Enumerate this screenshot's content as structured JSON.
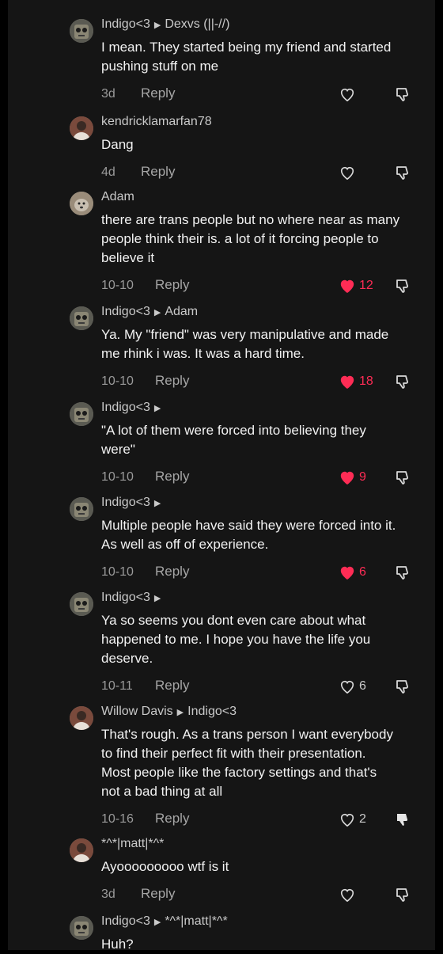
{
  "comments": [
    {
      "author": "Indigo<3",
      "reply_to": "Dexvs (||-//)",
      "avatar": "robot-avatar",
      "lines": [
        "I mean. They started being my friend and started",
        "pushing stuff on me"
      ],
      "time": "3d",
      "reply_label": "Reply",
      "likes": "",
      "liked": false,
      "disliked": false
    },
    {
      "author": "kendricklamarfan78",
      "reply_to": "",
      "avatar": "person-avatar",
      "lines": [
        "Dang"
      ],
      "time": "4d",
      "reply_label": "Reply",
      "likes": "",
      "liked": false,
      "disliked": false
    },
    {
      "author": "Adam",
      "reply_to": "",
      "avatar": "dog-avatar",
      "lines": [
        "there are trans people but no where near as many",
        "people think their is. a lot of it forcing people to",
        "believe it"
      ],
      "time": "10-10",
      "reply_label": "Reply",
      "likes": "12",
      "liked": true,
      "disliked": false
    },
    {
      "author": "Indigo<3",
      "reply_to": "Adam",
      "avatar": "robot-avatar",
      "lines": [
        "Ya. My \"friend\" was very manipulative and made",
        "me rhink i was. It was a hard time."
      ],
      "time": "10-10",
      "reply_label": "Reply",
      "likes": "18",
      "liked": true,
      "disliked": false
    },
    {
      "author": "Indigo<3",
      "reply_to": "",
      "avatar": "robot-avatar",
      "lines": [
        "\"A lot of them were forced into believing they",
        "were\""
      ],
      "time": "10-10",
      "reply_label": "Reply",
      "likes": "9",
      "liked": true,
      "disliked": false
    },
    {
      "author": "Indigo<3",
      "reply_to": "",
      "avatar": "robot-avatar",
      "lines": [
        "Multiple people have said they were forced into it.",
        "As well as off of experience."
      ],
      "time": "10-10",
      "reply_label": "Reply",
      "likes": "6",
      "liked": true,
      "disliked": false
    },
    {
      "author": "Indigo<3",
      "reply_to": "",
      "avatar": "robot-avatar",
      "lines": [
        "Ya so seems you dont even care about what",
        "happened to me. I hope you have the life you",
        "deserve."
      ],
      "time": "10-11",
      "reply_label": "Reply",
      "likes": "6",
      "liked": false,
      "disliked": false
    },
    {
      "author": "Willow Davis",
      "reply_to": "Indigo<3",
      "avatar": "person-avatar",
      "lines": [
        "That's rough. As a trans person I want everybody",
        "to find their perfect fit with their presentation.",
        "Most people like the factory settings and that's",
        "not a bad thing at all"
      ],
      "time": "10-16",
      "reply_label": "Reply",
      "likes": "2",
      "liked": false,
      "disliked": true
    },
    {
      "author": "*^*|matt|*^*",
      "reply_to": "",
      "avatar": "person-avatar",
      "lines": [
        "Ayooooooooo wtf is it"
      ],
      "time": "3d",
      "reply_label": "Reply",
      "likes": "",
      "liked": false,
      "disliked": false
    },
    {
      "author": "Indigo<3",
      "reply_to": "*^*|matt|*^*",
      "avatar": "robot-avatar",
      "lines": [
        "Huh?"
      ],
      "time": "",
      "reply_label": "",
      "likes": "",
      "liked": false,
      "disliked": false
    }
  ],
  "colors": {
    "like_active": "#fe2c55",
    "background": "#151515",
    "text": "#f2f2f2",
    "muted": "#9a9a9a"
  }
}
